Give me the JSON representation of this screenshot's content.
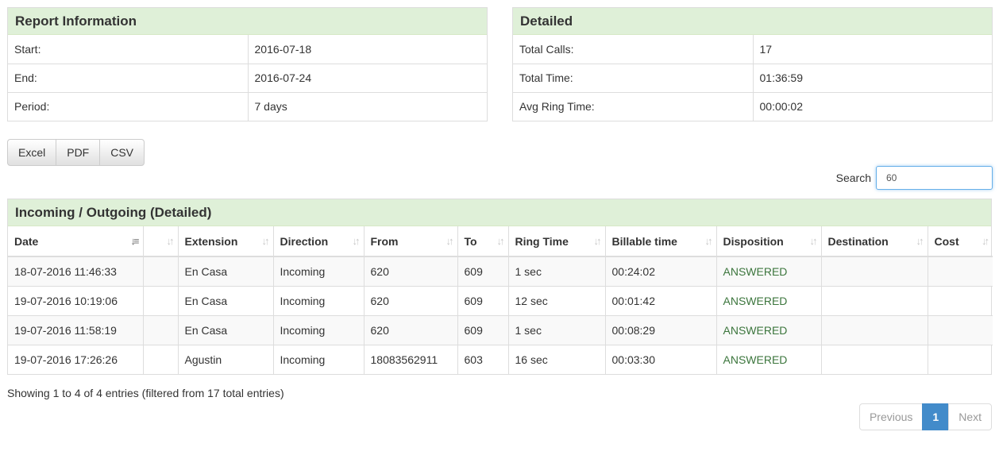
{
  "report_info": {
    "title": "Report Information",
    "rows": [
      {
        "label": "Start:",
        "value": "2016-07-18"
      },
      {
        "label": "End:",
        "value": "2016-07-24"
      },
      {
        "label": "Period:",
        "value": "7 days"
      }
    ]
  },
  "detailed": {
    "title": "Detailed",
    "rows": [
      {
        "label": "Total Calls:",
        "value": "17"
      },
      {
        "label": "Total Time:",
        "value": "01:36:59"
      },
      {
        "label": "Avg Ring Time:",
        "value": "00:00:02"
      }
    ]
  },
  "export": {
    "excel": "Excel",
    "pdf": "PDF",
    "csv": "CSV"
  },
  "search": {
    "label": "Search",
    "value": "60"
  },
  "table": {
    "title": "Incoming / Outgoing (Detailed)",
    "columns": [
      "Date",
      "",
      "Extension",
      "Direction",
      "From",
      "To",
      "Ring Time",
      "Billable time",
      "Disposition",
      "Destination",
      "Cost"
    ],
    "rows": [
      [
        "18-07-2016 11:46:33",
        "",
        "En Casa",
        "Incoming",
        "620",
        "609",
        "1 sec",
        "00:24:02",
        "ANSWERED",
        "",
        ""
      ],
      [
        "19-07-2016 10:19:06",
        "",
        "En Casa",
        "Incoming",
        "620",
        "609",
        "12 sec",
        "00:01:42",
        "ANSWERED",
        "",
        ""
      ],
      [
        "19-07-2016 11:58:19",
        "",
        "En Casa",
        "Incoming",
        "620",
        "609",
        "1 sec",
        "00:08:29",
        "ANSWERED",
        "",
        ""
      ],
      [
        "19-07-2016 17:26:26",
        "",
        "Agustin",
        "Incoming",
        "18083562911",
        "603",
        "16 sec",
        "00:03:30",
        "ANSWERED",
        "",
        ""
      ]
    ]
  },
  "info": "Showing 1 to 4 of 4 entries (filtered from 17 total entries)",
  "pagination": {
    "previous": "Previous",
    "current": "1",
    "next": "Next"
  },
  "colors": {
    "panel_header": "#dff0d8",
    "answered": "#3c763d",
    "active_page": "#428bca"
  }
}
